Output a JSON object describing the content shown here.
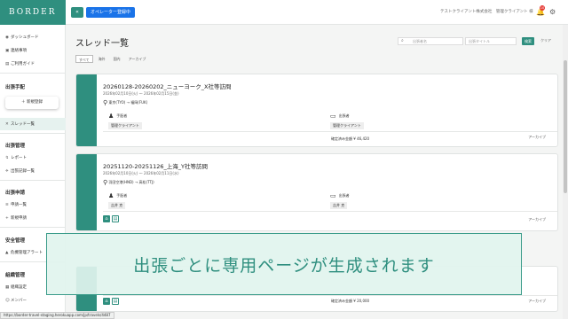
{
  "app": {
    "logo": "BORDER",
    "collapse_icon": "«",
    "operator_button": "オペレーター登録中",
    "company_user": "テストクライアント株式会社　管理クライアント 様",
    "notification_count": "10"
  },
  "sidebar": {
    "top_items": [
      {
        "label": "ダッシュボード",
        "icon": "dashboard-icon"
      },
      {
        "label": "連絡事項",
        "icon": "mail-icon"
      },
      {
        "label": "ご利用ガイド",
        "icon": "book-icon"
      }
    ],
    "sections": [
      {
        "heading": "出張手配",
        "items": [
          {
            "label": "新規登録"
          },
          {
            "label": "スレッド一覧"
          }
        ]
      },
      {
        "heading": "出張管理",
        "items": [
          {
            "label": "レポート"
          },
          {
            "label": "出張記録一覧"
          }
        ]
      },
      {
        "heading": "出張申請",
        "items": [
          {
            "label": "申請一覧"
          },
          {
            "label": "新規申請"
          }
        ]
      },
      {
        "heading": "安全管理",
        "items": [
          {
            "label": "危機管理アラート"
          }
        ]
      },
      {
        "heading": "組織管理",
        "items": [
          {
            "label": "組織設定"
          },
          {
            "label": "メンバー"
          }
        ]
      }
    ]
  },
  "main": {
    "title": "スレッド一覧",
    "search_placeholder_a": "出張者名",
    "search_placeholder_b": "出張タイトル",
    "search_button": "検索",
    "clear_link": "クリア",
    "tabs": [
      "すべて",
      "海外",
      "国内",
      "アーカイブ"
    ],
    "cards": [
      {
        "title": "20260128-20260202_ニューヨーク_X社等訪問",
        "dates": "2026年02月10日(火) 〜 2026年02月15日(金)",
        "route": "東京(TYO) → 福岡(FUK)",
        "role_a": "手配者",
        "role_b": "出張者",
        "tag_a": "管理クライアント",
        "tag_b": "管理クライアント",
        "amount": "確定済み金額 ¥ 46,420",
        "archive": "アーカイブ"
      },
      {
        "title": "20251120-20251126_上海_Y社等訪問",
        "dates": "2026年02月10日(火) 〜 2026年02月11日(水)",
        "route": "羽田空港(HND) → 高松(TTJ)",
        "role_a": "手配者",
        "role_b": "出張者",
        "tag_a": "吉井 克",
        "tag_b": "吉井 克",
        "amount": "",
        "archive": "アーカイブ"
      },
      {
        "amount": "確定済み金額 ¥ 20,000",
        "archive": "アーカイブ"
      }
    ]
  },
  "overlay": {
    "text": "出張ごとに専用ページが生成されます"
  },
  "status_bar": {
    "url": "https://border-travel-staging.herokuapp.com/jp/travels/4487"
  }
}
